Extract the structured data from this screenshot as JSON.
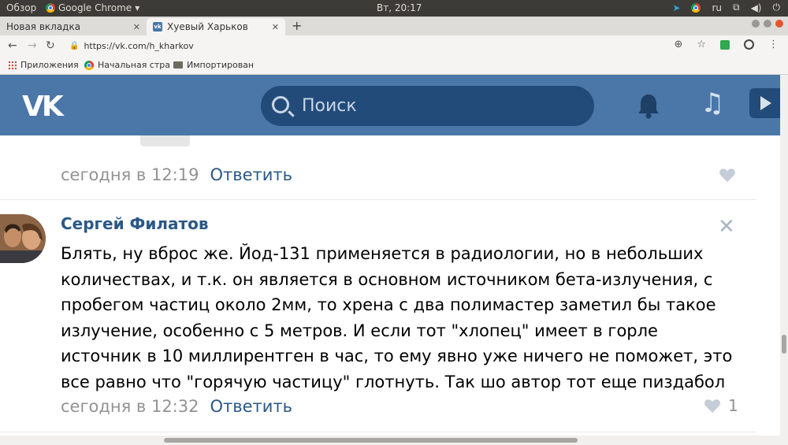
{
  "os": {
    "overview": "Обзор",
    "app_name": "Google Chrome",
    "clock": "Вт, 20:17",
    "lang": "ru"
  },
  "tabs": [
    {
      "label": "Новая вкладка"
    },
    {
      "label": "Хуевый Харьков"
    }
  ],
  "address": {
    "url": "https://vk.com/h_kharkov"
  },
  "bookmarks": [
    {
      "label": "Приложения"
    },
    {
      "label": "Начальная стра"
    },
    {
      "label": "Импортирован"
    }
  ],
  "vk": {
    "logo": "VK",
    "search_placeholder": "Поиск"
  },
  "comments": [
    {
      "time": "сегодня в 12:19",
      "reply_label": "Ответить",
      "likes": ""
    },
    {
      "author": "Сергей Филатов",
      "text_lines": [
        "Блять, ну вброс же. Йод-131 применяется в радиологии, но в небольших",
        "количествах, и т.к. он является в основном источником бета-излучения, с",
        "пробегом частиц около 2мм, то хрена с два полимастер заметил бы такое",
        "излучение, особенно с 5 метров. И если тот \"хлопец\" имеет в горле",
        "источник в 10 миллирентген в час, то ему явно уже ничего не поможет, это",
        "все равно что \"горячую частицу\" глотнуть. Так шо автор тот еще пиздабол"
      ],
      "time": "сегодня в 12:32",
      "reply_label": "Ответить",
      "likes": "1"
    }
  ],
  "colors": {
    "vk_blue": "#4a76a8",
    "link_blue": "#2a5885",
    "meta_gray": "#939393"
  }
}
